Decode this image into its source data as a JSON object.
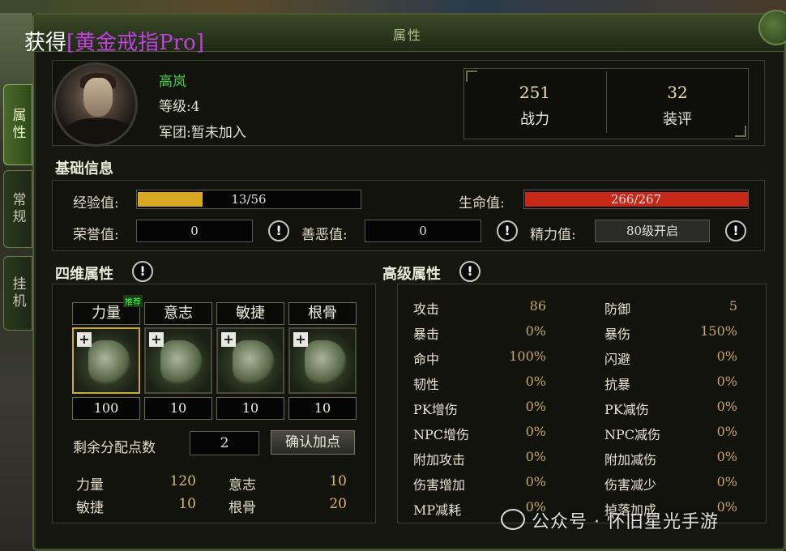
{
  "window": {
    "title": "属性"
  },
  "side_tabs": [
    {
      "label": "属性",
      "active": true
    },
    {
      "label": "常规",
      "active": false
    },
    {
      "label": "挂机",
      "active": false
    }
  ],
  "notice": {
    "prefix": "获得",
    "item": "[黄金戒指Pro]"
  },
  "character": {
    "name": "高岚",
    "level": "等级:4",
    "guild": "军团:暂未加入"
  },
  "header_stats": [
    {
      "value": "251",
      "label": "战力"
    },
    {
      "value": "32",
      "label": "装评"
    }
  ],
  "basic_info": {
    "title": "基础信息",
    "exp_label": "经验值:",
    "exp_value": "13/56",
    "exp_fraction": 0.232,
    "hp_label": "生命值:",
    "hp_value": "266/267",
    "hp_fraction": 0.996,
    "honor_label": "荣誉值:",
    "honor_value": "0",
    "karma_label": "善恶值:",
    "karma_value": "0",
    "energy_label": "精力值:",
    "energy_value": "80级开启"
  },
  "four_dim": {
    "title": "四维属性",
    "recommend_badge": "推荐",
    "attrs": [
      {
        "name": "力量",
        "value": "100"
      },
      {
        "name": "意志",
        "value": "10"
      },
      {
        "name": "敏捷",
        "value": "10"
      },
      {
        "name": "根骨",
        "value": "10"
      }
    ],
    "remaining_label": "剩余分配点数",
    "remaining_value": "2",
    "confirm_button": "确认加点",
    "summary": [
      {
        "name": "力量",
        "value": "120"
      },
      {
        "name": "意志",
        "value": "10"
      },
      {
        "name": "敏捷",
        "value": "10"
      },
      {
        "name": "根骨",
        "value": "20"
      }
    ]
  },
  "advanced": {
    "title": "高级属性",
    "left": [
      {
        "name": "攻击",
        "value": "86"
      },
      {
        "name": "暴击",
        "value": "0%"
      },
      {
        "name": "命中",
        "value": "100%"
      },
      {
        "name": "韧性",
        "value": "0%"
      },
      {
        "name": "PK增伤",
        "value": "0%"
      },
      {
        "name": "NPC增伤",
        "value": "0%"
      },
      {
        "name": "附加攻击",
        "value": "0%"
      },
      {
        "name": "伤害增加",
        "value": "0%"
      },
      {
        "name": "MP减耗",
        "value": "0%"
      }
    ],
    "right": [
      {
        "name": "防御",
        "value": "5"
      },
      {
        "name": "暴伤",
        "value": "150%"
      },
      {
        "name": "闪避",
        "value": "0%"
      },
      {
        "name": "抗暴",
        "value": "0%"
      },
      {
        "name": "PK减伤",
        "value": "0%"
      },
      {
        "name": "NPC减伤",
        "value": "0%"
      },
      {
        "name": "附加减伤",
        "value": "0%"
      },
      {
        "name": "伤害减少",
        "value": "0%"
      },
      {
        "name": "掉落加成",
        "value": "0%"
      }
    ]
  },
  "watermark": "公众号 · 怀旧星光手游",
  "colors": {
    "exp_bar": "#d8a820",
    "hp_bar": "#c82818",
    "name_green": "#40d040",
    "item_purple": "#c040e0"
  }
}
